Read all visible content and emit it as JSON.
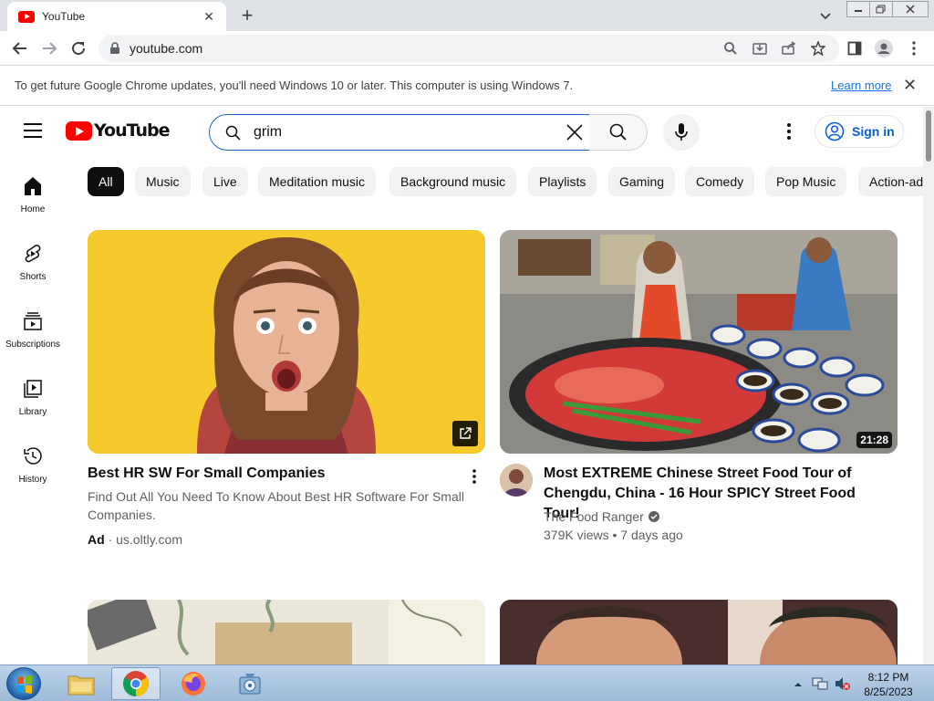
{
  "browser": {
    "tab_title": "YouTube",
    "url": "youtube.com"
  },
  "infobar": {
    "message": "To get future Google Chrome updates, you'll need Windows 10 or later. This computer is using Windows 7.",
    "link": "Learn more"
  },
  "youtube": {
    "logo_text": "YouTube",
    "search_value": "grim",
    "signin_label": "Sign in"
  },
  "sidebar": {
    "items": [
      {
        "label": "Home",
        "icon": "home-icon"
      },
      {
        "label": "Shorts",
        "icon": "shorts-icon"
      },
      {
        "label": "Subscriptions",
        "icon": "subscriptions-icon"
      },
      {
        "label": "Library",
        "icon": "library-icon"
      },
      {
        "label": "History",
        "icon": "history-icon"
      }
    ]
  },
  "chips": [
    "All",
    "Music",
    "Live",
    "Meditation music",
    "Background music",
    "Playlists",
    "Gaming",
    "Comedy",
    "Pop Music",
    "Action-ad"
  ],
  "videos": [
    {
      "title": "Best HR SW For Small Companies",
      "description": "Find Out All You Need To Know About Best HR Software For Small Companies.",
      "ad_label": "Ad",
      "ad_domain": "us.oltly.com"
    },
    {
      "title": "Most EXTREME Chinese Street Food Tour of Chengdu, China - 16 Hour SPICY Street Food Tour!",
      "channel": "The Food Ranger",
      "stats": "379K views • 7 days ago",
      "duration": "21:28"
    }
  ],
  "taskbar": {
    "time": "8:12 PM",
    "date": "8/25/2023"
  },
  "colors": {
    "youtube_red": "#ff0000",
    "link_blue": "#065fd4",
    "chrome_tab_bar": "#dee1e6"
  }
}
